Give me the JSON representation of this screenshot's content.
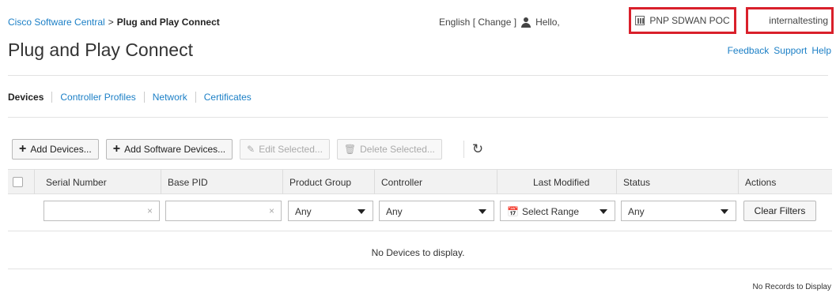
{
  "header": {
    "breadcrumb_root": "Cisco Software Central",
    "breadcrumb_sep": ">",
    "breadcrumb_current": "Plug and Play Connect",
    "title": "Plug and Play Connect",
    "language": "English [ Change ]",
    "greeting": "Hello,",
    "account": "PNP SDWAN POC",
    "user": "internaltesting",
    "links": [
      "Feedback",
      "Support",
      "Help"
    ]
  },
  "tabs": [
    "Devices",
    "Controller Profiles",
    "Network",
    "Certificates"
  ],
  "toolbar": {
    "add_devices": "Add Devices...",
    "add_software_devices": "Add Software Devices...",
    "edit_selected": "Edit Selected...",
    "delete_selected": "Delete Selected..."
  },
  "table": {
    "columns": [
      "Serial Number",
      "Base PID",
      "Product Group",
      "Controller",
      "Last Modified",
      "Status",
      "Actions"
    ],
    "filters": {
      "product_group": "Any",
      "controller": "Any",
      "last_modified": "Select Range",
      "status": "Any",
      "clear_icon": "×"
    },
    "clear_filters": "Clear Filters",
    "empty_message": "No Devices to display."
  },
  "footer": {
    "records": "No Records to Display"
  },
  "colors": {
    "link": "#1b7fc6",
    "highlight_border": "#d9202b"
  }
}
